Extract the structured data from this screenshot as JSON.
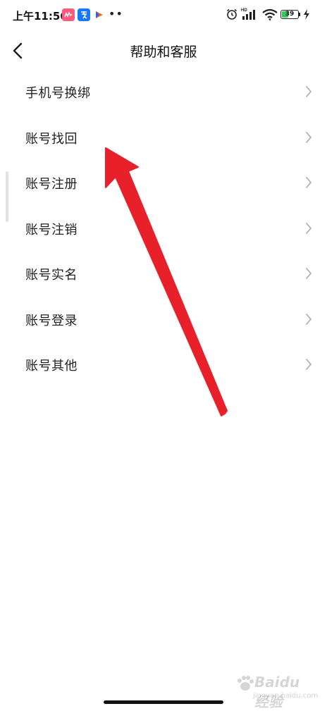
{
  "status_bar": {
    "time": "上午11:56",
    "app_icons": [
      "video-app-icon",
      "alipay-icon",
      "flag-app-icon"
    ],
    "battery_level": "39",
    "network_badge": "HD",
    "colors": {
      "battery": "#34c759"
    }
  },
  "nav": {
    "title": "帮助和客服",
    "back_icon": "chevron-left-icon"
  },
  "menu": {
    "items": [
      {
        "label": "手机号换绑"
      },
      {
        "label": "账号找回"
      },
      {
        "label": "账号注册"
      },
      {
        "label": "账号注销"
      },
      {
        "label": "账号实名"
      },
      {
        "label": "账号登录"
      },
      {
        "label": "账号其他"
      }
    ],
    "item_icon": "chevron-right-icon"
  },
  "annotation": {
    "icon": "red-arrow-annotation",
    "color": "#e8202a"
  },
  "watermark": {
    "brand": "Baidu 经验",
    "sub": "jingyan.baidu.com"
  }
}
